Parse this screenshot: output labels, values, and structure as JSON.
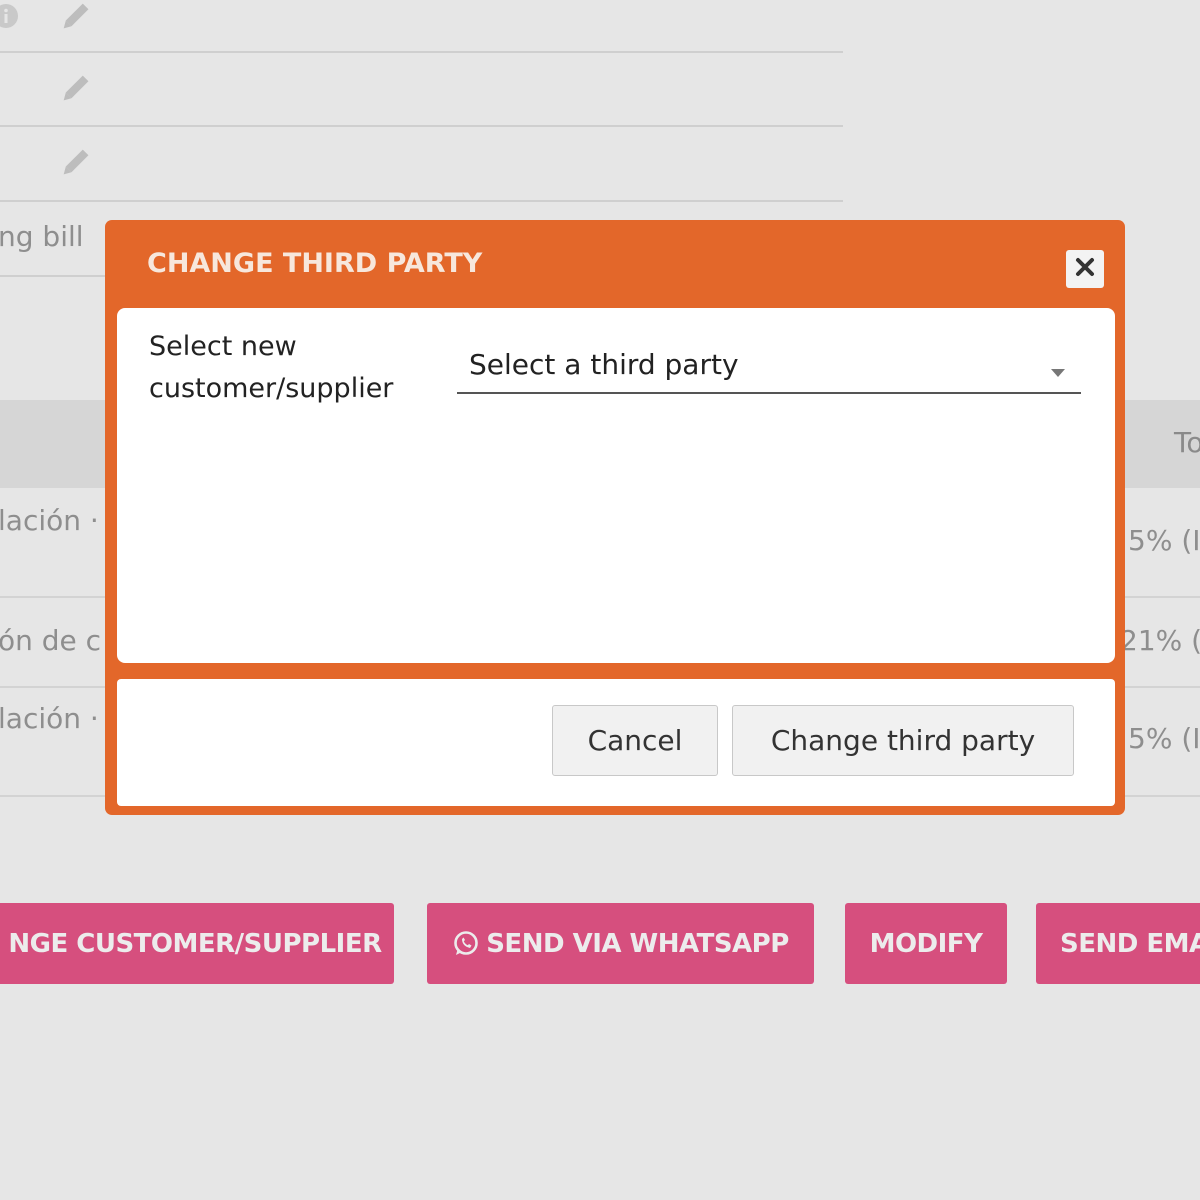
{
  "background": {
    "partial_text_bill": "ng bill",
    "table_header_partial": "To",
    "rows": [
      {
        "desc_partial": "lación ·",
        "tax_partial": "5% (II"
      },
      {
        "desc_partial": "ón de c",
        "tax_partial": "21% (II"
      },
      {
        "desc_partial": "lación ·",
        "tax_partial": "5% (II"
      }
    ],
    "actions": [
      {
        "label": "NGE CUSTOMER/SUPPLIER"
      },
      {
        "label": "SEND VIA WHATSAPP"
      },
      {
        "label": "MODIFY"
      },
      {
        "label": "SEND EMA"
      }
    ]
  },
  "modal": {
    "title": "CHANGE THIRD PARTY",
    "field_label": "Select new customer/supplier",
    "select_placeholder": "Select a third party",
    "cancel_label": "Cancel",
    "submit_label": "Change third party"
  },
  "colors": {
    "modal_accent": "#e3672a",
    "action_button": "#d64f7e",
    "page_background": "#e6e6e6"
  },
  "icons": [
    "info-icon",
    "pencil-icon",
    "close-icon",
    "caret-down-icon",
    "whatsapp-icon"
  ]
}
